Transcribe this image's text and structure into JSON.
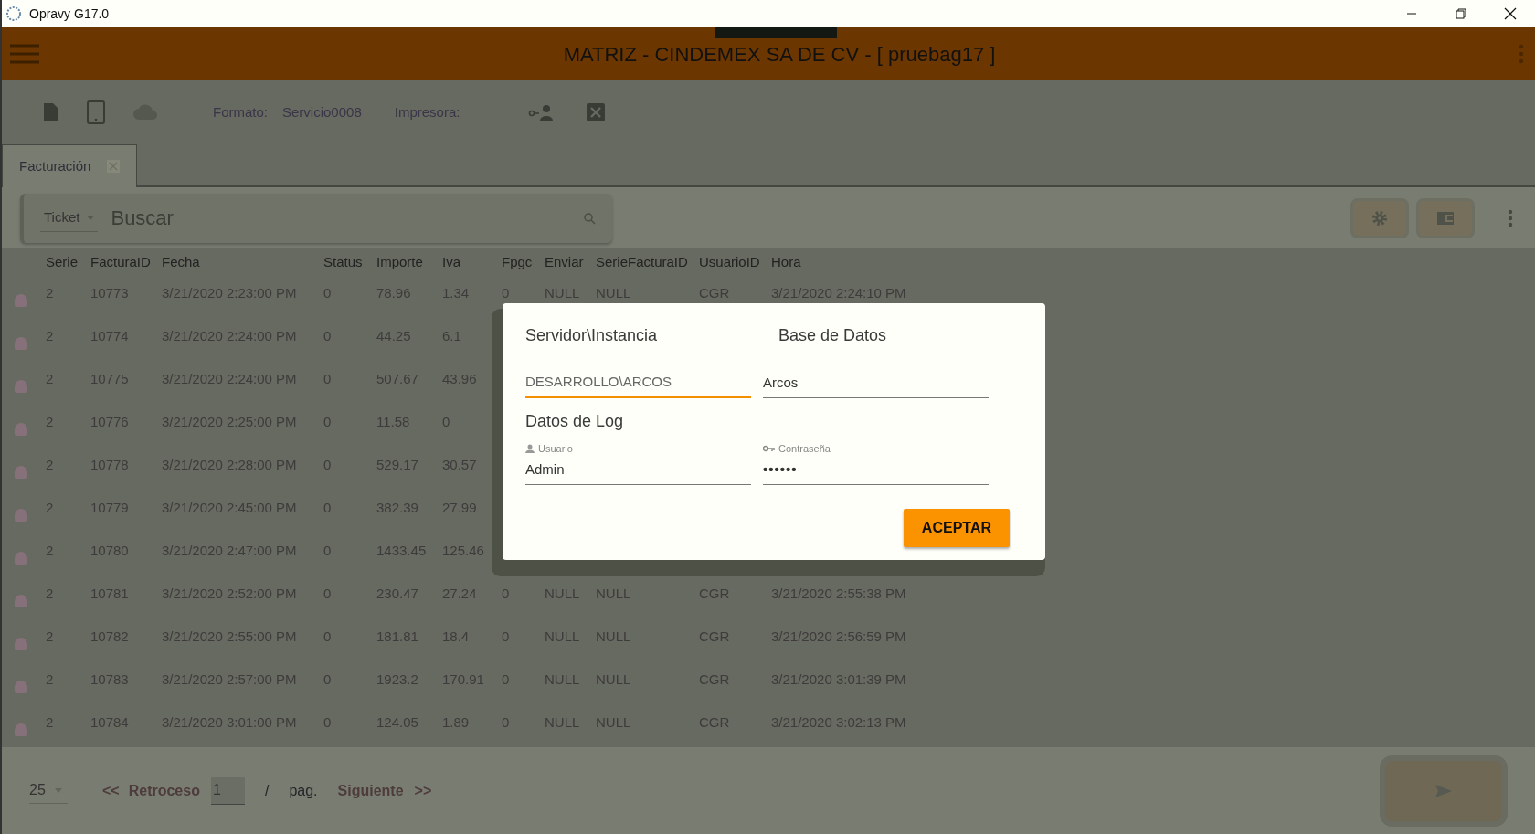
{
  "window": {
    "title": "Opravy G17.0"
  },
  "header": {
    "title": "MATRIZ - CINDEMEX SA DE CV - [ pruebag17 ]"
  },
  "toolbar": {
    "format_label": "Formato:",
    "format_value": "Servicio0008",
    "printer_label": "Impresora:"
  },
  "tabs": [
    {
      "label": "Facturación",
      "selected": true
    }
  ],
  "search": {
    "type_value": "Ticket",
    "placeholder": "Buscar"
  },
  "table": {
    "columns": [
      "Serie",
      "FacturaID",
      "Fecha",
      "Status",
      "Importe",
      "Iva",
      "Fpgc",
      "Enviar",
      "SerieFacturaID",
      "UsuarioID",
      "Hora"
    ],
    "rows": [
      [
        "2",
        "10773",
        "3/21/2020 2:23:00 PM",
        "0",
        "78.96",
        "1.34",
        "0",
        "NULL",
        "NULL",
        "CGR",
        "3/21/2020 2:24:10 PM"
      ],
      [
        "2",
        "10774",
        "3/21/2020 2:24:00 PM",
        "0",
        "44.25",
        "6.1"
      ],
      [
        "2",
        "10775",
        "3/21/2020 2:24:00 PM",
        "0",
        "507.67",
        "43.96"
      ],
      [
        "2",
        "10776",
        "3/21/2020 2:25:00 PM",
        "0",
        "11.58",
        "0"
      ],
      [
        "2",
        "10778",
        "3/21/2020 2:28:00 PM",
        "0",
        "529.17",
        "30.57"
      ],
      [
        "2",
        "10779",
        "3/21/2020 2:45:00 PM",
        "0",
        "382.39",
        "27.99"
      ],
      [
        "2",
        "10780",
        "3/21/2020 2:47:00 PM",
        "0",
        "1433.45",
        "125.46"
      ],
      [
        "2",
        "10781",
        "3/21/2020 2:52:00 PM",
        "0",
        "230.47",
        "27.24",
        "0",
        "NULL",
        "NULL",
        "CGR",
        "3/21/2020 2:55:38 PM"
      ],
      [
        "2",
        "10782",
        "3/21/2020 2:55:00 PM",
        "0",
        "181.81",
        "18.4",
        "0",
        "NULL",
        "NULL",
        "CGR",
        "3/21/2020 2:56:59 PM"
      ],
      [
        "2",
        "10783",
        "3/21/2020 2:57:00 PM",
        "0",
        "1923.2",
        "170.91",
        "0",
        "NULL",
        "NULL",
        "CGR",
        "3/21/2020 3:01:39 PM"
      ],
      [
        "2",
        "10784",
        "3/21/2020 3:01:00 PM",
        "0",
        "124.05",
        "1.89",
        "0",
        "NULL",
        "NULL",
        "CGR",
        "3/21/2020 3:02:13 PM"
      ]
    ]
  },
  "pager": {
    "page_size": "25",
    "prev_arrows": "<<",
    "prev_label": "Retroceso",
    "page": "1",
    "separator": "/",
    "page_label": "pag.",
    "next_label": "Siguiente",
    "next_arrows": ">>"
  },
  "dialog": {
    "headings": [
      "Servidor\\Instancia",
      "Base de Datos"
    ],
    "fields": [
      {
        "value": "DESARROLLO\\ARCOS",
        "focused": true
      },
      {
        "value": "Arcos",
        "focused": false
      }
    ],
    "section_label": "Datos de Log",
    "login_fields": [
      {
        "kind": "user",
        "label": "Usuario",
        "value": "Admin"
      },
      {
        "kind": "password",
        "label": "Contraseña",
        "value": "••••••"
      }
    ],
    "button": "ACEPTAR"
  }
}
